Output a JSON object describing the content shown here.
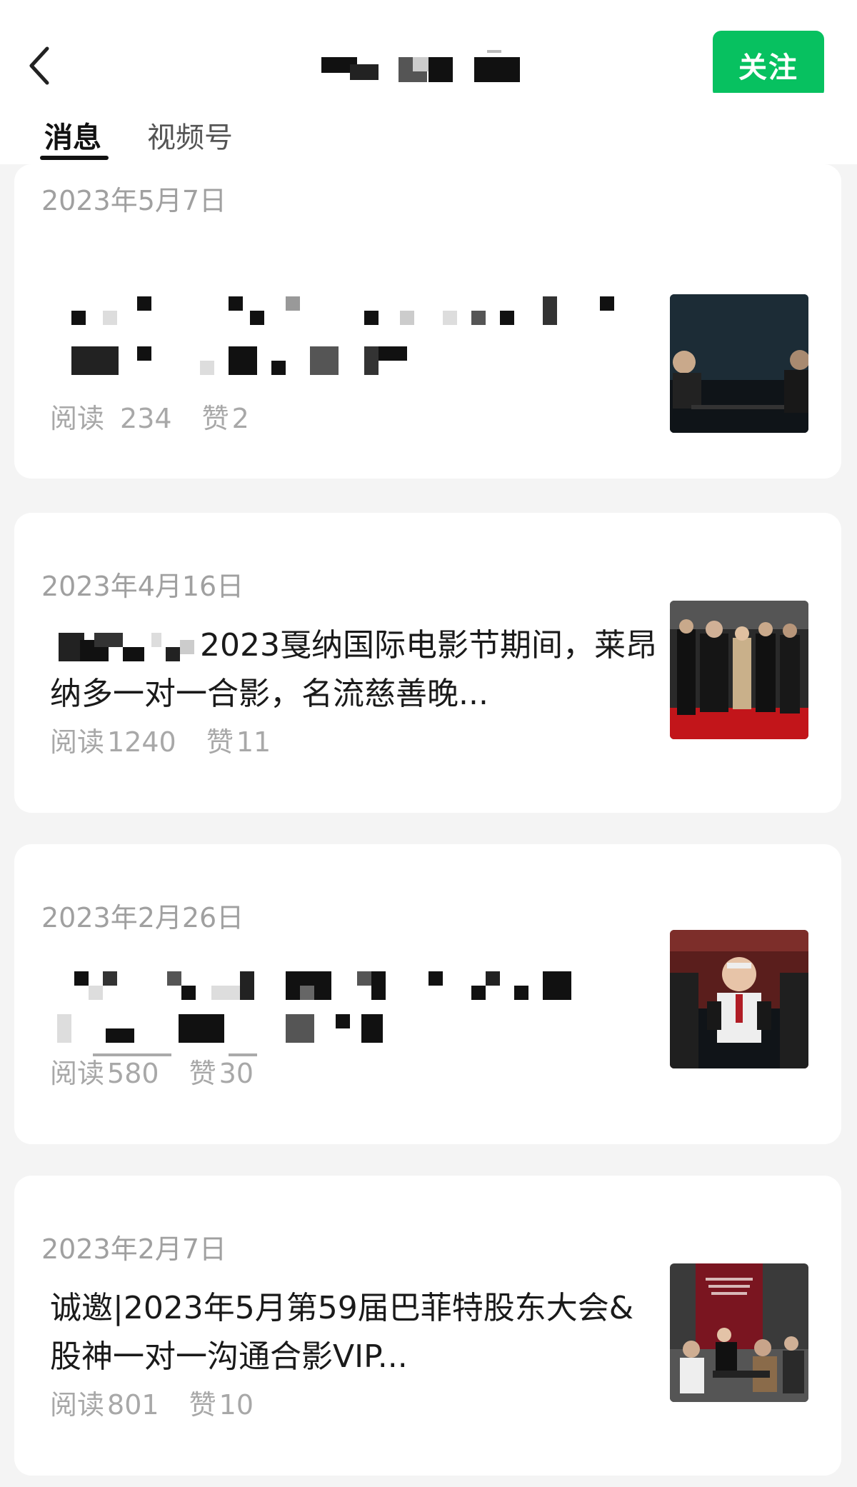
{
  "header": {
    "follow_label": "关注"
  },
  "tabs": [
    {
      "label": "消息"
    },
    {
      "label": "视频号"
    }
  ],
  "posts": [
    {
      "date": "2023年5月7日",
      "title": "",
      "read_label": "阅读",
      "read_count": "234",
      "like_label": "赞",
      "like_count": "2"
    },
    {
      "date": "2023年4月16日",
      "title": "2023戛纳国际电影节期间，莱昂纳多一对一合影，名流慈善晚...",
      "read_label": "阅读",
      "read_count": "1240",
      "like_label": "赞",
      "like_count": "11"
    },
    {
      "date": "2023年2月26日",
      "title": "",
      "read_label": "阅读",
      "read_count": "580",
      "like_label": "赞",
      "like_count": "30"
    },
    {
      "date": "2023年2月7日",
      "title": "诚邀|2023年5月第59届巴菲特股东大会&股神一对一沟通合影VIP...",
      "read_label": "阅读",
      "read_count": "801",
      "like_label": "赞",
      "like_count": "10"
    }
  ],
  "colors": {
    "accent": "#07c160",
    "background": "#f4f4f4",
    "card": "#ffffff",
    "muted": "#a0a0a0"
  },
  "icons": {
    "back": "chevron-left-icon"
  }
}
